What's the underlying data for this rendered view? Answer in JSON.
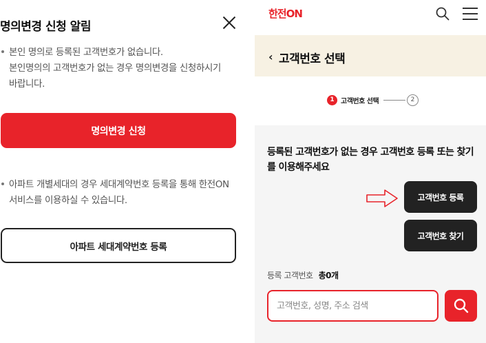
{
  "dialog": {
    "title": "명의변경 신청 알림",
    "notice1_line1": "본인 명의로 등록된 고객번호가 없습니다.",
    "notice1_line2": "본인명의의 고객번호가 없는 경우 명의변경을 신청하시기",
    "notice1_line3": "바랍니다.",
    "apply_button": "명의변경 신청",
    "notice2_line1": "아파트 개별세대의 경우 세대계약번호 등록을 통해 한전ON",
    "notice2_line2": "서비스를 이용하실 수 있습니다.",
    "apartment_button": "아파트 세대계약번호 등록"
  },
  "app": {
    "logo": "한전ON",
    "page_title": "고객번호 선택",
    "step1_number": "1",
    "step1_label": "고객번호 선택",
    "step2_number": "2",
    "info_text": "등록된 고객번호가 없는 경우 고객번호 등록 또는 찾기를 이용해주세요",
    "register_button": "고객번호 등록",
    "find_button": "고객번호 찾기",
    "count_label": "등록 고객번호",
    "count_value": "총0개",
    "search_placeholder": "고객번호, 성명, 주소 검색"
  },
  "colors": {
    "accent": "#e8232a",
    "dark_button": "#222222",
    "header_band": "#f7f1e3",
    "panel_bg": "#f5f5f5"
  }
}
